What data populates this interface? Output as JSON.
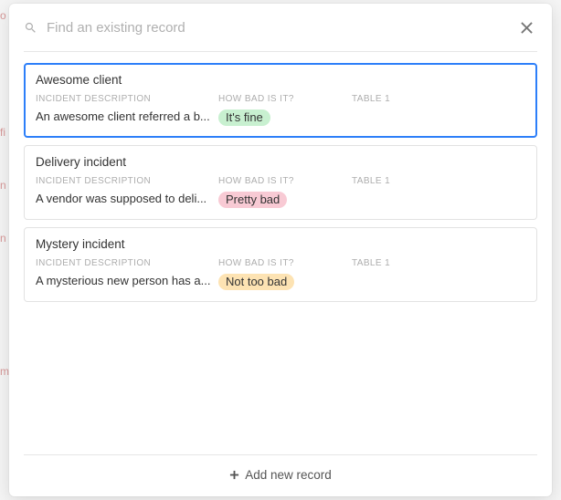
{
  "search": {
    "placeholder": "Find an existing record"
  },
  "columns": {
    "description_label": "INCIDENT DESCRIPTION",
    "severity_label": "HOW BAD IS IT?",
    "table_label": "TABLE 1"
  },
  "records": [
    {
      "title": "Awesome client",
      "description": "An awesome client referred a b...",
      "severity": "It's fine",
      "severity_color": "green",
      "selected": true
    },
    {
      "title": "Delivery incident",
      "description": "A vendor was supposed to deli...",
      "severity": "Pretty bad",
      "severity_color": "pink",
      "selected": false
    },
    {
      "title": "Mystery incident",
      "description": "A mysterious new person has a...",
      "severity": "Not too bad",
      "severity_color": "amber",
      "selected": false
    }
  ],
  "footer": {
    "add_label": "Add new record"
  },
  "background_hints": [
    "o",
    "fi",
    "n",
    "n",
    "m"
  ]
}
